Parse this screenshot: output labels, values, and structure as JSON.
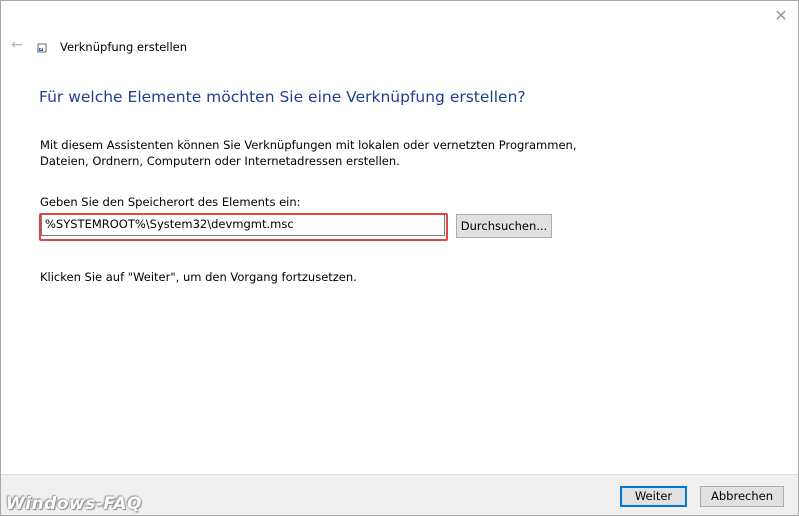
{
  "window": {
    "title": "Verknüpfung erstellen",
    "close_icon": "close-icon",
    "back_icon": "back-arrow-icon"
  },
  "main": {
    "heading": "Für welche Elemente möchten Sie eine Verknüpfung erstellen?",
    "description": "Mit diesem Assistenten können Sie Verknüpfungen mit lokalen oder vernetzten Programmen, Dateien, Ordnern, Computern oder Internetadressen erstellen.",
    "field_label": "Geben Sie den Speicherort des Elements ein:",
    "path_value": "%SYSTEMROOT%\\System32\\devmgmt.msc",
    "browse_label": "Durchsuchen...",
    "hint": "Klicken Sie auf \"Weiter\", um den Vorgang fortzusetzen."
  },
  "footer": {
    "next_label": "Weiter",
    "cancel_label": "Abbrechen"
  },
  "watermark": "Windows-FAQ",
  "colors": {
    "heading": "#1f3f8f",
    "highlight": "#e04646",
    "accent": "#0078d7"
  }
}
